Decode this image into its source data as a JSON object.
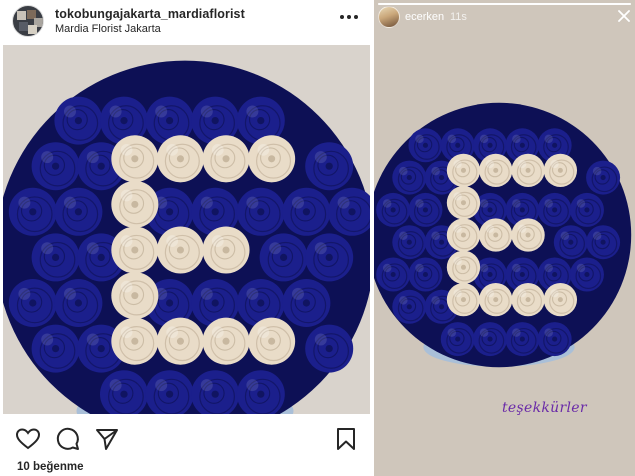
{
  "post": {
    "username": "tokobungajakarta_mardiaflorist",
    "location": "Mardia Florist Jakarta",
    "likes": "10 beğenme",
    "icons": [
      "more-icon",
      "heart-icon",
      "comment-icon",
      "share-icon",
      "bookmark-icon"
    ]
  },
  "story": {
    "username": "ecerken",
    "time": "11s",
    "caption": "teşekkürler",
    "icons": [
      "close-icon"
    ]
  },
  "colors": {
    "rose_blue": "#1b1f8c",
    "rose_dark": "#0c0f4e",
    "rose_cream": "#e9dcc8",
    "caption_purple": "#6a2aa8",
    "text": "#262626"
  }
}
